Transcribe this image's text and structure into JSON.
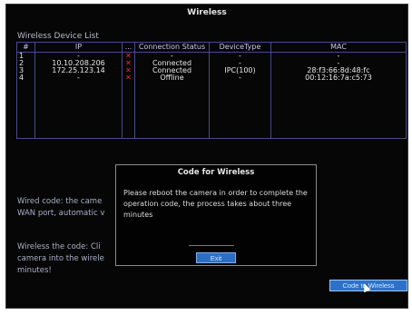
{
  "window": {
    "title": "Wireless"
  },
  "device_list": {
    "label": "Wireless Device List",
    "columns": [
      "#",
      "IP",
      "...",
      "Connection Status",
      "DeviceType",
      "MAC"
    ],
    "rows": [
      {
        "num": "1",
        "ip": "-",
        "status": "-",
        "type": "-",
        "mac": "-"
      },
      {
        "num": "2",
        "ip": "10.10.208.206",
        "status": "Connected",
        "type": "-",
        "mac": "-"
      },
      {
        "num": "3",
        "ip": "172.25.123.14",
        "status": "Connected",
        "type": "IPC(100)",
        "mac": "28:f3:66:8d:48:fc"
      },
      {
        "num": "4",
        "ip": "-",
        "status": "Offline",
        "type": "-",
        "mac": "00:12:16:7a:c5:73"
      }
    ]
  },
  "background": {
    "wired_line1": "Wired code: the came",
    "wired_line2": "WAN port, automatic v",
    "wireless_line1": "Wireless the code: Cli",
    "wireless_line2": "camera into the wirele",
    "wireless_line3": "minutes!"
  },
  "dialog": {
    "title": "Code for Wireless",
    "message": "Please reboot the camera in order to complete the operation code, the process takes about three minutes",
    "exit_label": "Exit"
  },
  "buttons": {
    "code_wireless": "Code to Wireless"
  },
  "icons": {
    "remove": "x-icon",
    "cursor": "mouse-pointer-icon"
  },
  "colors": {
    "accent": "#2e72c8",
    "remove": "#ff2a2a",
    "background": "#060606"
  }
}
